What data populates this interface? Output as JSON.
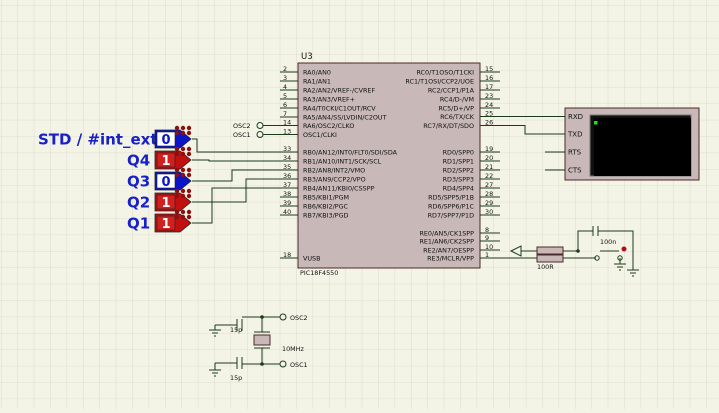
{
  "chip": {
    "designator": "U3",
    "part": "PIC18F4550",
    "left_pins": [
      {
        "num": "2",
        "label": "RA0/AN0"
      },
      {
        "num": "3",
        "label": "RA1/AN1"
      },
      {
        "num": "4",
        "label": "RA2/AN2/VREF-/CVREF"
      },
      {
        "num": "5",
        "label": "RA3/AN3/VREF+"
      },
      {
        "num": "6",
        "label": "RA4/T0CKI/C1OUT/RCV"
      },
      {
        "num": "7",
        "label": "RA5/AN4/SS/LVDIN/C2OUT"
      },
      {
        "num": "14",
        "label": "RA6/OSC2/CLKO"
      },
      {
        "num": "13",
        "label": "OSC1/CLKI"
      },
      {
        "num": "33",
        "label": "RB0/AN12/INT0/FLT0/SDI/SDA"
      },
      {
        "num": "34",
        "label": "RB1/AN10/INT1/SCK/SCL"
      },
      {
        "num": "35",
        "label": "RB2/AN8/INT2/VMO"
      },
      {
        "num": "36",
        "label": "RB3/AN9/CCP2/VPO"
      },
      {
        "num": "37",
        "label": "RB4/AN11/KBI0/CSSPP"
      },
      {
        "num": "38",
        "label": "RB5/KBI1/PGM"
      },
      {
        "num": "39",
        "label": "RB6/KBI2/PGC"
      },
      {
        "num": "40",
        "label": "RB7/KBI3/PGD"
      },
      {
        "num": "18",
        "label": "VUSB"
      }
    ],
    "right_pins": [
      {
        "num": "15",
        "label": "RC0/T1OSO/T1CKI"
      },
      {
        "num": "16",
        "label": "RC1/T1OSI/CCP2/UOE"
      },
      {
        "num": "17",
        "label": "RC2/CCP1/P1A"
      },
      {
        "num": "23",
        "label": "RC4/D-/VM"
      },
      {
        "num": "24",
        "label": "RC5/D+/VP"
      },
      {
        "num": "25",
        "label": "RC6/TX/CK"
      },
      {
        "num": "26",
        "label": "RC7/RX/DT/SDO"
      },
      {
        "num": "19",
        "label": "RD0/SPP0"
      },
      {
        "num": "20",
        "label": "RD1/SPP1"
      },
      {
        "num": "21",
        "label": "RD2/SPP2"
      },
      {
        "num": "22",
        "label": "RD3/SPP3"
      },
      {
        "num": "27",
        "label": "RD4/SPP4"
      },
      {
        "num": "28",
        "label": "RD5/SPP5/P1B"
      },
      {
        "num": "29",
        "label": "RD6/SPP6/P1C"
      },
      {
        "num": "30",
        "label": "RD7/SPP7/P1D"
      },
      {
        "num": "8",
        "label": "RE0/AN5/CK1SPP"
      },
      {
        "num": "9",
        "label": "RE1/AN6/CK2SPP"
      },
      {
        "num": "10",
        "label": "RE2/AN7/OESPP"
      },
      {
        "num": "1",
        "label": "RE3/MCLR/VPP"
      }
    ]
  },
  "osc_terminals": {
    "osc2": "OSC2",
    "osc1": "OSC1"
  },
  "inputs": [
    {
      "label": "STD / #int_ext",
      "state": "0"
    },
    {
      "label": "Q4",
      "state": "1"
    },
    {
      "label": "Q3",
      "state": "0"
    },
    {
      "label": "Q2",
      "state": "1"
    },
    {
      "label": "Q1",
      "state": "1"
    }
  ],
  "terminal": {
    "pins": [
      "RXD",
      "TXD",
      "RTS",
      "CTS"
    ]
  },
  "reset": {
    "resistor": "100R",
    "capacitor": "100n"
  },
  "crystal": {
    "value": "10MHz",
    "cap1": "15p",
    "cap2": "15p",
    "osc2": "OSC2",
    "osc1": "OSC1"
  },
  "colors": {
    "background": "#f4f4e6",
    "grid": "#c9cbc0",
    "wire": "#1a3a1a",
    "component_body": "#c8b8b8",
    "input_blue": "#0a14c8",
    "input_red": "#c01010",
    "label_blue": "#1820c8"
  }
}
